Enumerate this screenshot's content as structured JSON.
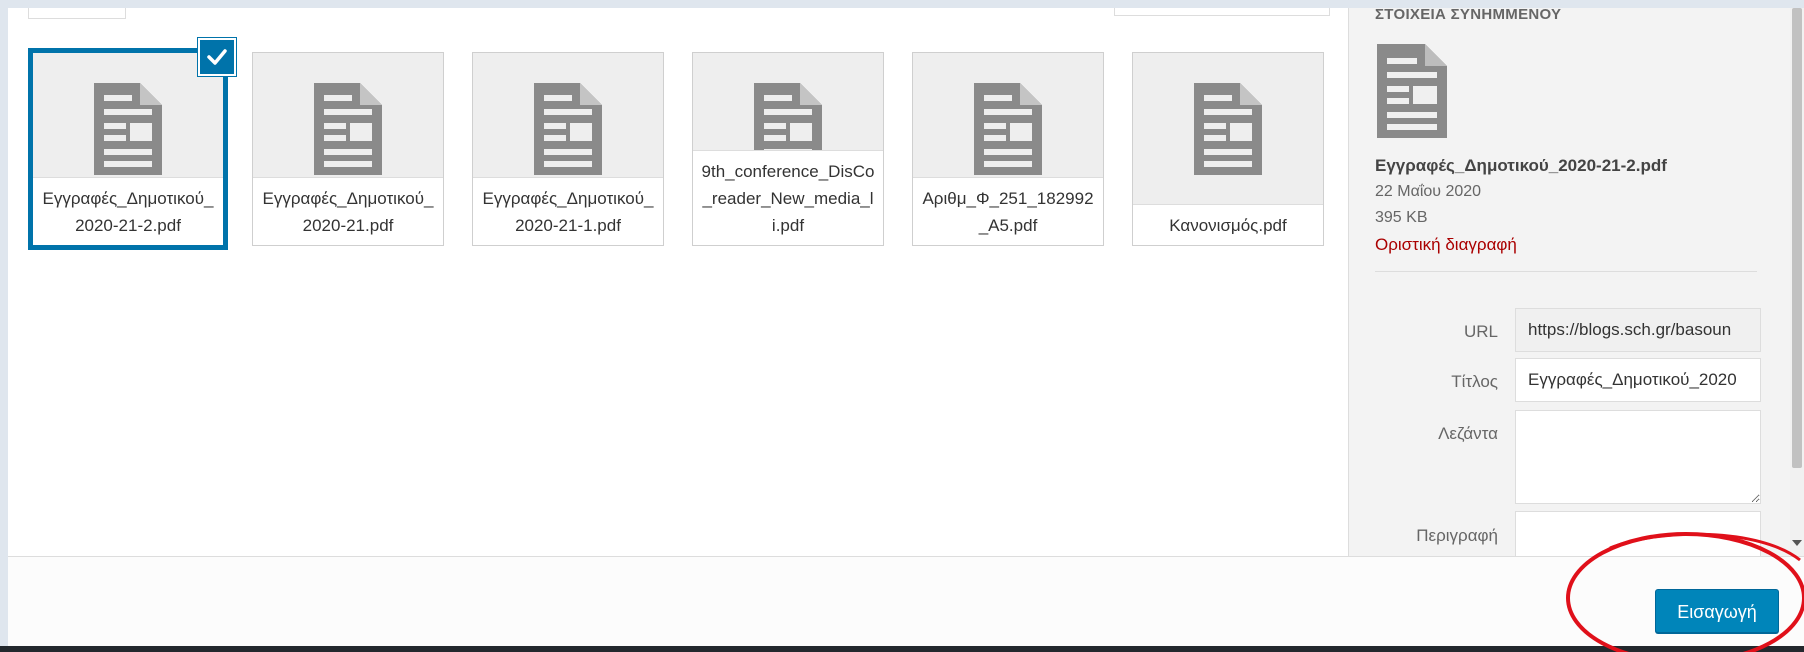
{
  "attachments": [
    {
      "filename": "Εγγραφές_Δημοτικού_2020-21-2.pdf",
      "selected": true
    },
    {
      "filename": "Εγγραφές_Δημοτικού_2020-21.pdf",
      "selected": false
    },
    {
      "filename": "Εγγραφές_Δημοτικού_2020-21-1.pdf",
      "selected": false
    },
    {
      "filename": "9th_conference_DisCo_reader_New_media_li.pdf",
      "selected": false
    },
    {
      "filename": "Αριθμ_Φ_251_182992_Α5.pdf",
      "selected": false
    },
    {
      "filename": "Κανονισμός.pdf",
      "selected": false
    }
  ],
  "details": {
    "heading": "ΣΤΟΙΧΕΙΑ ΣΥΝΗΜΜΕΝΟΥ",
    "filename": "Εγγραφές_Δημοτικού_2020-21-2.pdf",
    "date": "22 Μαΐου 2020",
    "size": "395 KB",
    "delete_label": "Οριστική διαγραφή",
    "url_label": "URL",
    "url_value": "https://blogs.sch.gr/basoun",
    "title_label": "Τίτλος",
    "title_value": "Εγγραφές_Δημοτικού_2020",
    "caption_label": "Λεζάντα",
    "caption_value": "",
    "description_label": "Περιγραφή",
    "description_value": ""
  },
  "footer": {
    "insert_label": "Εισαγωγή"
  },
  "colors": {
    "accent": "#0085ba",
    "selection": "#0073aa",
    "delete": "#a00000",
    "annotation": "#e0101a"
  }
}
